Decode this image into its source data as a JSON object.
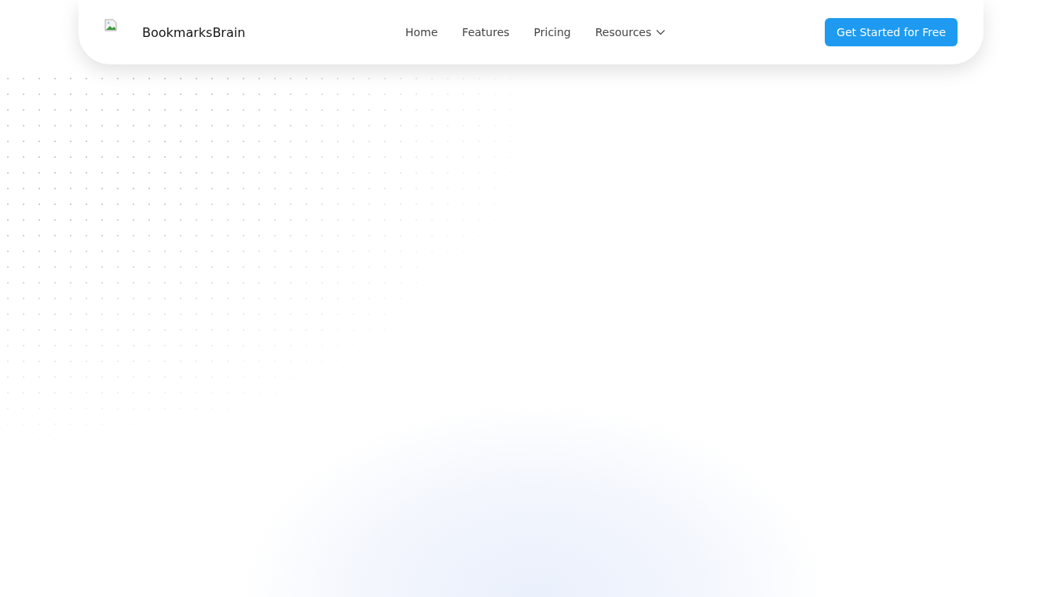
{
  "header": {
    "brand": "BookmarksBrain",
    "nav": [
      {
        "label": "Home",
        "kind": "link"
      },
      {
        "label": "Features",
        "kind": "link"
      },
      {
        "label": "Pricing",
        "kind": "link"
      },
      {
        "label": "Resources",
        "kind": "dropdown"
      }
    ],
    "cta": "Get Started for Free"
  }
}
